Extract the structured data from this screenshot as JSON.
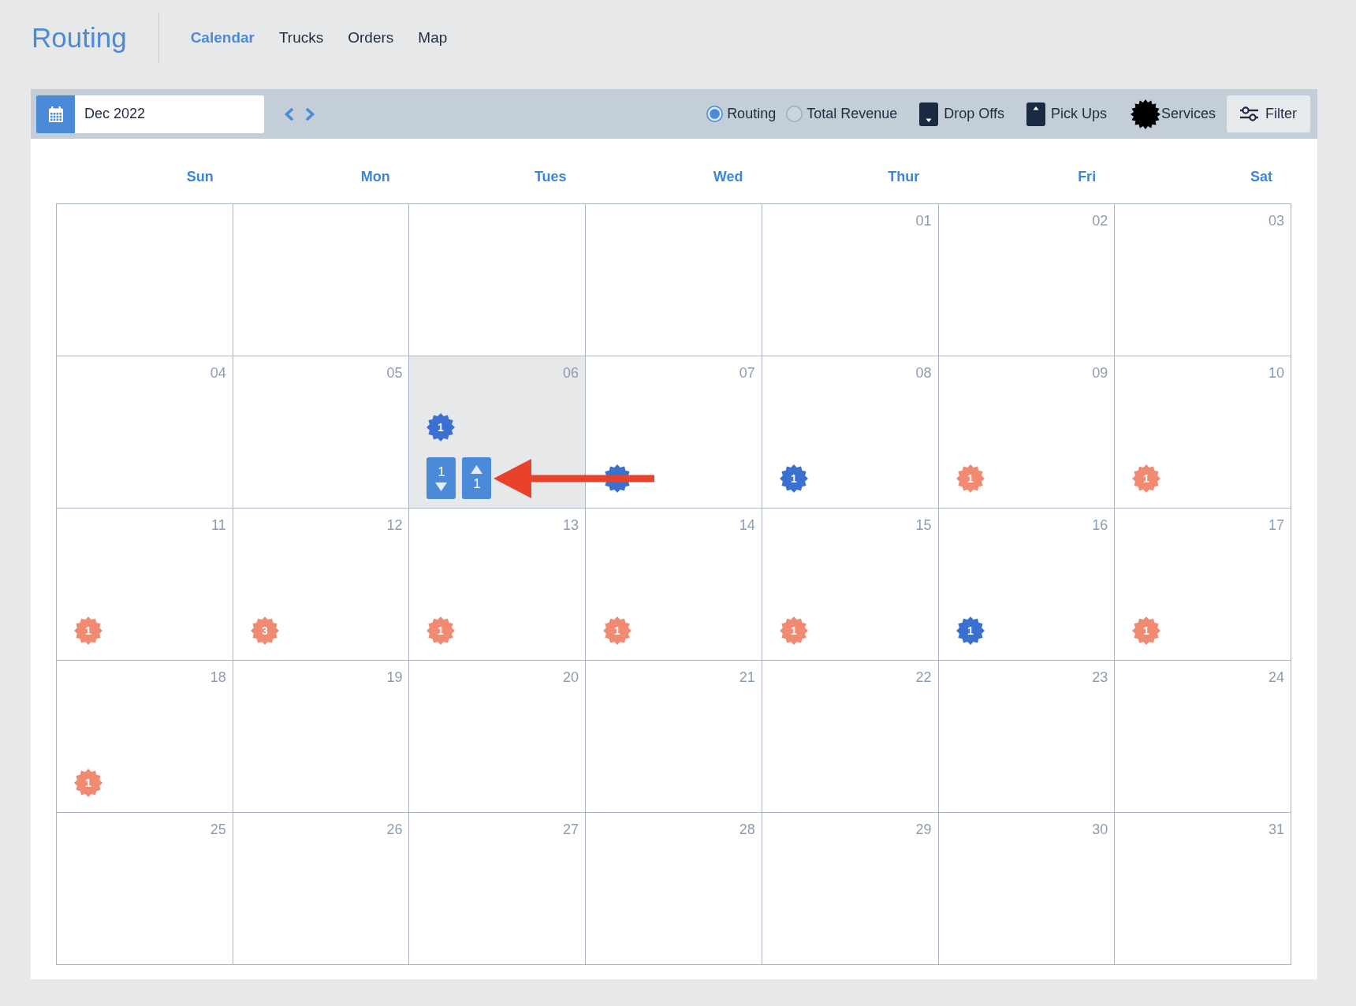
{
  "app_title": "Routing",
  "nav": [
    {
      "label": "Calendar",
      "selected": true
    },
    {
      "label": "Trucks",
      "selected": false
    },
    {
      "label": "Orders",
      "selected": false
    },
    {
      "label": "Map",
      "selected": false
    }
  ],
  "toolbar": {
    "date_field": {
      "value": "Dec 2022"
    },
    "view_options": [
      {
        "label": "Routing",
        "selected": true
      },
      {
        "label": "Total Revenue",
        "selected": false
      }
    ],
    "legend": [
      {
        "kind": "drop_off",
        "label": "Drop Offs"
      },
      {
        "kind": "pick_up",
        "label": "Pick Ups"
      },
      {
        "kind": "service",
        "label": "Services"
      }
    ],
    "filter_button": {
      "label": "Filter"
    }
  },
  "calendar": {
    "weekdays": [
      "Sun",
      "Mon",
      "Tues",
      "Wed",
      "Thur",
      "Fri",
      "Sat"
    ],
    "weeks": [
      [
        {
          "kind": "blank",
          "selected": false
        },
        {
          "kind": "blank",
          "selected": false
        },
        {
          "kind": "blank",
          "selected": false
        },
        {
          "kind": "blank",
          "selected": false
        },
        {
          "kind": "day",
          "day": "01",
          "selected": false
        },
        {
          "kind": "day",
          "day": "02",
          "selected": false
        },
        {
          "kind": "day",
          "day": "03",
          "selected": false
        }
      ],
      [
        {
          "kind": "day",
          "day": "04",
          "selected": false
        },
        {
          "kind": "day",
          "day": "05",
          "selected": false
        },
        {
          "kind": "day",
          "day": "06",
          "selected": true,
          "badges": [
            {
              "count": "1",
              "color": "#3a70cf"
            }
          ],
          "stops": [
            {
              "kind": "drop_off",
              "count": "1"
            },
            {
              "kind": "pick_up",
              "count": "1"
            }
          ],
          "arrow": true
        },
        {
          "kind": "day",
          "day": "07",
          "selected": false,
          "badges": [
            {
              "color": "#3a70cf"
            }
          ]
        },
        {
          "kind": "day",
          "day": "08",
          "selected": false,
          "badges": [
            {
              "count": "1",
              "color": "#3a70cf"
            }
          ]
        },
        {
          "kind": "day",
          "day": "09",
          "selected": false,
          "badges": [
            {
              "count": "1",
              "color": "#f08b71"
            }
          ]
        },
        {
          "kind": "day",
          "day": "10",
          "selected": false,
          "badges": [
            {
              "count": "1",
              "color": "#f08b71"
            }
          ]
        }
      ],
      [
        {
          "kind": "day",
          "day": "11",
          "selected": false,
          "badges": [
            {
              "count": "1",
              "color": "#f08b71"
            }
          ]
        },
        {
          "kind": "day",
          "day": "12",
          "selected": false,
          "badges": [
            {
              "count": "3",
              "color": "#f08b71"
            }
          ]
        },
        {
          "kind": "day",
          "day": "13",
          "selected": false,
          "badges": [
            {
              "count": "1",
              "color": "#f08b71"
            }
          ]
        },
        {
          "kind": "day",
          "day": "14",
          "selected": false,
          "badges": [
            {
              "count": "1",
              "color": "#f08b71"
            }
          ]
        },
        {
          "kind": "day",
          "day": "15",
          "selected": false,
          "badges": [
            {
              "count": "1",
              "color": "#f08b71"
            }
          ]
        },
        {
          "kind": "day",
          "day": "16",
          "selected": false,
          "badges": [
            {
              "count": "1",
              "color": "#3a70cf"
            }
          ]
        },
        {
          "kind": "day",
          "day": "17",
          "selected": false,
          "badges": [
            {
              "count": "1",
              "color": "#f08b71"
            }
          ]
        }
      ],
      [
        {
          "kind": "day",
          "day": "18",
          "selected": false,
          "badges": [
            {
              "count": "1",
              "color": "#f08b71"
            }
          ]
        },
        {
          "kind": "day",
          "day": "19",
          "selected": false
        },
        {
          "kind": "day",
          "day": "20",
          "selected": false
        },
        {
          "kind": "day",
          "day": "21",
          "selected": false
        },
        {
          "kind": "day",
          "day": "22",
          "selected": false
        },
        {
          "kind": "day",
          "day": "23",
          "selected": false
        },
        {
          "kind": "day",
          "day": "24",
          "selected": false
        }
      ],
      [
        {
          "kind": "day",
          "day": "25",
          "selected": false
        },
        {
          "kind": "day",
          "day": "26",
          "selected": false
        },
        {
          "kind": "day",
          "day": "27",
          "selected": false
        },
        {
          "kind": "day",
          "day": "28",
          "selected": false
        },
        {
          "kind": "day",
          "day": "29",
          "selected": false
        },
        {
          "kind": "day",
          "day": "30",
          "selected": false
        },
        {
          "kind": "day",
          "day": "31",
          "selected": false
        }
      ]
    ]
  }
}
